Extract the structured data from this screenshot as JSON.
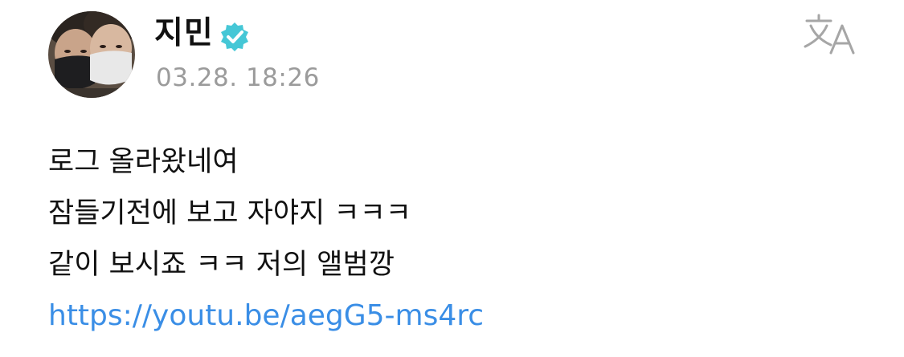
{
  "post": {
    "author": "지민",
    "verified": true,
    "timestamp": "03.28. 18:26",
    "translate_icon": "translate-icon",
    "avatar_icon": "avatar",
    "lines": [
      "로그 올라왔네여",
      "잠들기전에 보고 자야지 ㅋㅋㅋ",
      "같이 보시죠 ㅋㅋ 저의 앨범깡"
    ],
    "link": "https://youtu.be/aegG5-ms4rc"
  },
  "colors": {
    "verified_badge": "#45c7d6",
    "link": "#3a8ee6",
    "timestamp": "#9b9b9b",
    "icon_gray": "#a6a6a6"
  }
}
